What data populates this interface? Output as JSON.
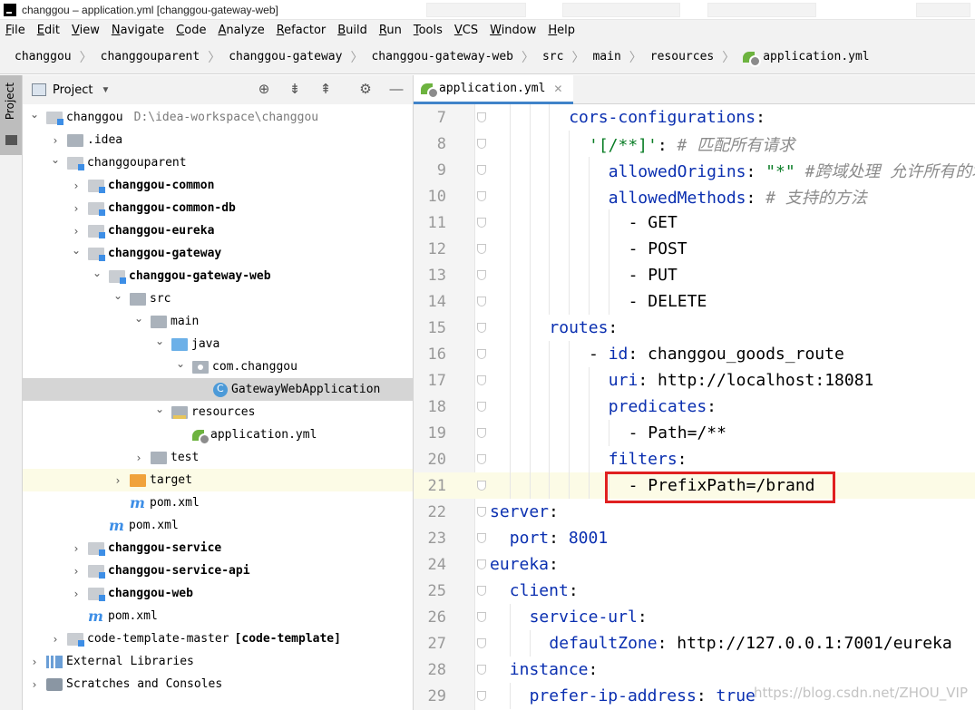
{
  "window": {
    "title": "changgou – application.yml [changgou-gateway-web]"
  },
  "menu": [
    "File",
    "Edit",
    "View",
    "Navigate",
    "Code",
    "Analyze",
    "Refactor",
    "Build",
    "Run",
    "Tools",
    "VCS",
    "Window",
    "Help"
  ],
  "breadcrumb": [
    "changgou",
    "changgouparent",
    "changgou-gateway",
    "changgou-gateway-web",
    "src",
    "main",
    "resources",
    "application.yml"
  ],
  "toolstrip": {
    "project_tab": "Project"
  },
  "project_panel": {
    "title": "Project",
    "tree": [
      {
        "label": "changgou",
        "hint": "D:\\idea-workspace\\changgou",
        "icon": "module-folder-icon",
        "depth": 0,
        "expanded": true
      },
      {
        "label": ".idea",
        "icon": "folder-icon",
        "depth": 1,
        "expanded": false
      },
      {
        "label": "changgouparent",
        "icon": "module-folder-icon",
        "depth": 1,
        "expanded": true
      },
      {
        "label": "changgou-common",
        "icon": "module-folder-icon",
        "depth": 2,
        "expanded": false,
        "bold": true
      },
      {
        "label": "changgou-common-db",
        "icon": "module-folder-icon",
        "depth": 2,
        "expanded": false,
        "bold": true
      },
      {
        "label": "changgou-eureka",
        "icon": "module-folder-icon",
        "depth": 2,
        "expanded": false,
        "bold": true
      },
      {
        "label": "changgou-gateway",
        "icon": "module-folder-icon",
        "depth": 2,
        "expanded": true,
        "bold": true
      },
      {
        "label": "changgou-gateway-web",
        "icon": "module-folder-icon",
        "depth": 3,
        "expanded": true,
        "bold": true
      },
      {
        "label": "src",
        "icon": "folder-icon",
        "depth": 4,
        "expanded": true
      },
      {
        "label": "main",
        "icon": "folder-icon",
        "depth": 5,
        "expanded": true
      },
      {
        "label": "java",
        "icon": "source-folder-icon",
        "depth": 6,
        "expanded": true
      },
      {
        "label": "com.changgou",
        "icon": "package-icon",
        "depth": 7,
        "expanded": true
      },
      {
        "label": "GatewayWebApplication",
        "icon": "spring-class-icon",
        "depth": 8,
        "leaf": true,
        "selected": true
      },
      {
        "label": "resources",
        "icon": "resources-folder-icon",
        "depth": 6,
        "expanded": true
      },
      {
        "label": "application.yml",
        "icon": "yaml-file-icon",
        "depth": 7,
        "leaf": true
      },
      {
        "label": "test",
        "icon": "folder-icon",
        "depth": 5,
        "expanded": false
      },
      {
        "label": "target",
        "icon": "excluded-folder-icon",
        "depth": 4,
        "expanded": false,
        "excluded": true
      },
      {
        "label": "pom.xml",
        "icon": "maven-icon",
        "depth": 4,
        "leaf": true
      },
      {
        "label": "pom.xml",
        "icon": "maven-icon",
        "depth": 3,
        "leaf": true
      },
      {
        "label": "changgou-service",
        "icon": "module-folder-icon",
        "depth": 2,
        "expanded": false,
        "bold": true
      },
      {
        "label": "changgou-service-api",
        "icon": "module-folder-icon",
        "depth": 2,
        "expanded": false,
        "bold": true
      },
      {
        "label": "changgou-web",
        "icon": "module-folder-icon",
        "depth": 2,
        "expanded": false,
        "bold": true
      },
      {
        "label": "pom.xml",
        "icon": "maven-icon",
        "depth": 2,
        "leaf": true
      },
      {
        "label": "code-template-master",
        "bracket": "[code-template]",
        "icon": "module-folder-icon",
        "depth": 1,
        "expanded": false
      },
      {
        "label": "External Libraries",
        "icon": "libraries-icon",
        "depth": 0,
        "expanded": false
      },
      {
        "label": "Scratches and Consoles",
        "icon": "scratches-icon",
        "depth": 0,
        "expanded": false
      }
    ]
  },
  "editor": {
    "tab_label": "application.yml",
    "lines": [
      {
        "no": "7",
        "indent": 4,
        "parts": [
          [
            "k",
            "cors-configurations"
          ],
          [
            "p",
            ":"
          ]
        ]
      },
      {
        "no": "8",
        "indent": 5,
        "parts": [
          [
            "s",
            "'[/**]'"
          ],
          [
            "p",
            ": "
          ],
          [
            "c",
            "# 匹配所有请求"
          ]
        ]
      },
      {
        "no": "9",
        "indent": 6,
        "parts": [
          [
            "k",
            "allowedOrigins"
          ],
          [
            "p",
            ": "
          ],
          [
            "s",
            "\"*\""
          ],
          [
            "p",
            " "
          ],
          [
            "c",
            "#跨域处理 允许所有的域"
          ]
        ]
      },
      {
        "no": "10",
        "indent": 6,
        "parts": [
          [
            "k",
            "allowedMethods"
          ],
          [
            "p",
            ": "
          ],
          [
            "c",
            "# 支持的方法"
          ]
        ]
      },
      {
        "no": "11",
        "indent": 7,
        "parts": [
          [
            "p",
            "- GET"
          ]
        ]
      },
      {
        "no": "12",
        "indent": 7,
        "parts": [
          [
            "p",
            "- POST"
          ]
        ]
      },
      {
        "no": "13",
        "indent": 7,
        "parts": [
          [
            "p",
            "- PUT"
          ]
        ]
      },
      {
        "no": "14",
        "indent": 7,
        "parts": [
          [
            "p",
            "- DELETE"
          ]
        ]
      },
      {
        "no": "15",
        "indent": 3,
        "parts": [
          [
            "k",
            "routes"
          ],
          [
            "p",
            ":"
          ]
        ]
      },
      {
        "no": "16",
        "indent": 5,
        "parts": [
          [
            "p",
            "- "
          ],
          [
            "k",
            "id"
          ],
          [
            "p",
            ": changgou_goods_route"
          ]
        ]
      },
      {
        "no": "17",
        "indent": 6,
        "parts": [
          [
            "k",
            "uri"
          ],
          [
            "p",
            ": http://localhost:18081"
          ]
        ]
      },
      {
        "no": "18",
        "indent": 6,
        "parts": [
          [
            "k",
            "predicates"
          ],
          [
            "p",
            ":"
          ]
        ]
      },
      {
        "no": "19",
        "indent": 7,
        "parts": [
          [
            "p",
            "- Path=/**"
          ]
        ]
      },
      {
        "no": "20",
        "indent": 6,
        "parts": [
          [
            "k",
            "filters"
          ],
          [
            "p",
            ":"
          ]
        ]
      },
      {
        "no": "21",
        "indent": 7,
        "parts": [
          [
            "p",
            "- PrefixPath=/brand"
          ]
        ],
        "current": true
      },
      {
        "no": "22",
        "indent": 0,
        "parts": [
          [
            "k",
            "server"
          ],
          [
            "p",
            ":"
          ]
        ]
      },
      {
        "no": "23",
        "indent": 1,
        "parts": [
          [
            "k",
            "port"
          ],
          [
            "p",
            ": "
          ],
          [
            "n",
            "8001"
          ]
        ]
      },
      {
        "no": "24",
        "indent": 0,
        "parts": [
          [
            "k",
            "eureka"
          ],
          [
            "p",
            ":"
          ]
        ]
      },
      {
        "no": "25",
        "indent": 1,
        "parts": [
          [
            "k",
            "client"
          ],
          [
            "p",
            ":"
          ]
        ]
      },
      {
        "no": "26",
        "indent": 2,
        "parts": [
          [
            "k",
            "service-url"
          ],
          [
            "p",
            ":"
          ]
        ]
      },
      {
        "no": "27",
        "indent": 3,
        "parts": [
          [
            "k",
            "defaultZone"
          ],
          [
            "p",
            ": http://127.0.0.1:7001/eureka"
          ]
        ]
      },
      {
        "no": "28",
        "indent": 1,
        "parts": [
          [
            "k",
            "instance"
          ],
          [
            "p",
            ":"
          ]
        ]
      },
      {
        "no": "29",
        "indent": 2,
        "parts": [
          [
            "k",
            "prefer-ip-address"
          ],
          [
            "p",
            ": "
          ],
          [
            "n",
            "true"
          ]
        ]
      }
    ]
  },
  "watermark": "https://blog.csdn.net/ZHOU_VIP",
  "colors": {
    "accent": "#4083c9",
    "highlight_box": "#e02020",
    "yaml_key": "#0a2fb0",
    "yaml_string": "#0a7d26",
    "comment": "#8c8c8c"
  }
}
